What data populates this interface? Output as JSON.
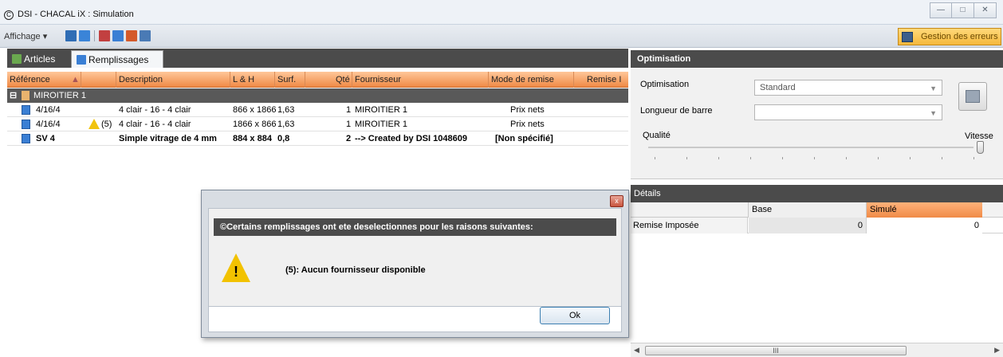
{
  "window": {
    "icon": "chacal-app-icon",
    "title": "DSI - CHACAL iX : Simulation",
    "controls": [
      "minimize-icon",
      "maximize-icon",
      "close-icon"
    ]
  },
  "toolbar": {
    "affichage_label": "Affichage",
    "icons": [
      "layout-icon",
      "layout-alt-icon",
      "delete-row-icon",
      "import-icon",
      "grid-add-icon",
      "export-icon"
    ],
    "errors_button": "Gestion des erreurs"
  },
  "tabs": [
    {
      "label": "Articles",
      "icon": "articles-icon",
      "active": false
    },
    {
      "label": "Remplissages",
      "icon": "remplissages-icon",
      "active": true
    }
  ],
  "grid": {
    "columns": [
      "Référence",
      "Description",
      "L & H",
      "Surf.",
      "Qté",
      "Fournisseur",
      "Mode de remise",
      "Remise I"
    ],
    "group": {
      "label": "MIROITIER 1",
      "icon": "supplier-icon"
    },
    "rows": [
      {
        "ref": "4/16/4",
        "flag": "",
        "description": "4 clair - 16 - 4 clair",
        "lh": "866 x 1866",
        "surf": "1,63",
        "qte": "1",
        "fournisseur": "MIROITIER 1",
        "mode": "Prix nets",
        "bold": false,
        "warn": false
      },
      {
        "ref": "4/16/4",
        "flag": "(5)",
        "description": "4 clair - 16 - 4 clair",
        "lh": "1866 x 866",
        "surf": "1,63",
        "qte": "1",
        "fournisseur": "MIROITIER 1",
        "mode": "Prix nets",
        "bold": false,
        "warn": true
      },
      {
        "ref": "SV 4",
        "flag": "",
        "description": "Simple vitrage de 4 mm",
        "lh": "884 x 884",
        "surf": "0,8",
        "qte": "2",
        "fournisseur": "--> Created by DSI 1048609",
        "mode": "[Non spécifié]",
        "bold": true,
        "warn": false
      }
    ]
  },
  "optimisation": {
    "header": "Optimisation",
    "label_optimisation": "Optimisation",
    "combo_value": "Standard",
    "label_longueur": "Longueur de barre",
    "longueur_value": "",
    "label_qualite": "Qualité",
    "label_vitesse": "Vitesse",
    "slider_level": 1.0
  },
  "details": {
    "header": "Détails",
    "col_base": "Base",
    "col_simule": "Simulé",
    "row_label": "Remise Imposée",
    "base_value": "0",
    "simule_value": "0",
    "scroll_thumb": "III"
  },
  "dialog": {
    "banner": "©Certains remplissages ont ete deselectionnes pour les raisons suivantes:",
    "message": "(5): Aucun fournisseur disponible",
    "ok_label": "Ok",
    "close_glyph": "x",
    "icon": "warning-icon"
  },
  "colors": {
    "accent_orange": "#f08a46",
    "dark_band": "#4b4b4b",
    "warning_yellow": "#f2c200"
  }
}
